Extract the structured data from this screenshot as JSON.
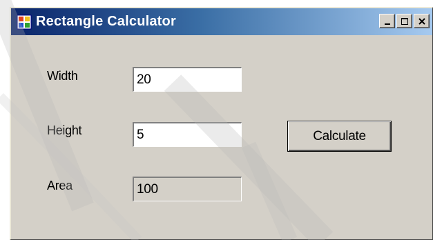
{
  "window": {
    "title": "Rectangle Calculator"
  },
  "form": {
    "width_label": "Width",
    "width_value": "20",
    "height_label": "Height",
    "height_value": "5",
    "area_label": "Area",
    "area_value": "100",
    "calculate_label": "Calculate"
  },
  "icons": {
    "app": "application-window-icon",
    "minimize": "minimize-icon",
    "maximize": "maximize-icon",
    "close": "close-icon"
  },
  "colors": {
    "titlebar_start": "#0a246a",
    "titlebar_end": "#a6caf0",
    "window_face": "#d4d0c8"
  }
}
